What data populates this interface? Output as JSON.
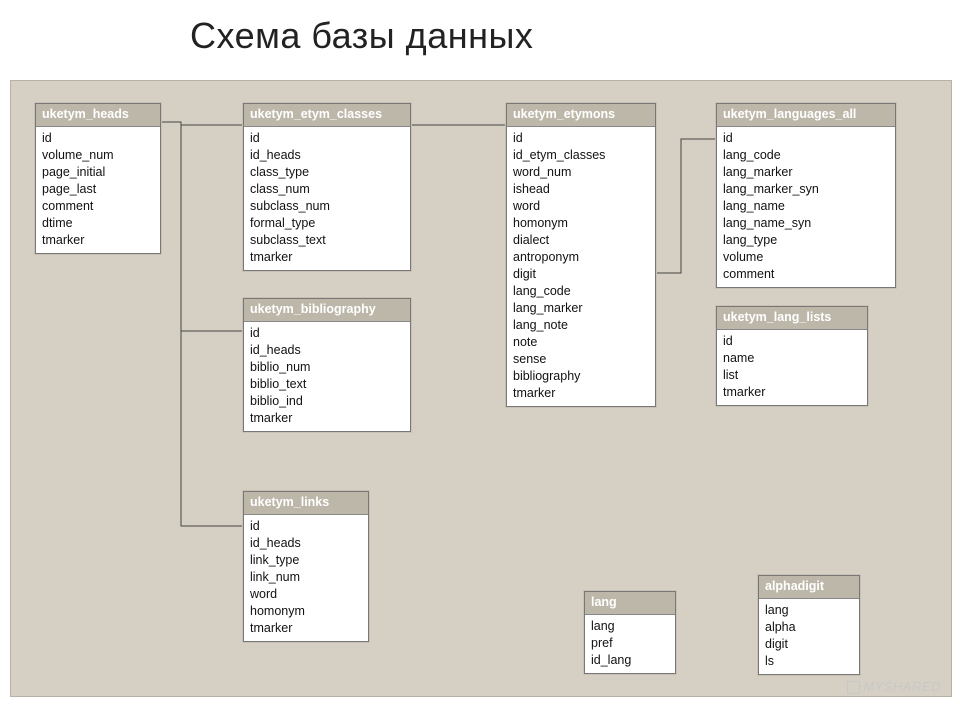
{
  "title": "Схема базы данных",
  "watermark": "MYSHARED",
  "tables": {
    "uketym_heads": {
      "title": "uketym_heads",
      "fields": [
        "id",
        "volume_num",
        "page_initial",
        "page_last",
        "comment",
        "dtime",
        "tmarker"
      ]
    },
    "uketym_etym_classes": {
      "title": "uketym_etym_classes",
      "fields": [
        "id",
        "id_heads",
        "class_type",
        "class_num",
        "subclass_num",
        "formal_type",
        "subclass_text",
        "tmarker"
      ]
    },
    "uketym_etymons": {
      "title": "uketym_etymons",
      "fields": [
        "id",
        "id_etym_classes",
        "word_num",
        "ishead",
        "word",
        "homonym",
        "dialect",
        "antroponym",
        "digit",
        "lang_code",
        "lang_marker",
        "lang_note",
        "note",
        "sense",
        "bibliography",
        "tmarker"
      ]
    },
    "uketym_languages_all": {
      "title": "uketym_languages_all",
      "fields": [
        "id",
        "lang_code",
        "lang_marker",
        "lang_marker_syn",
        "lang_name",
        "lang_name_syn",
        "lang_type",
        "volume",
        "comment"
      ]
    },
    "uketym_bibliography": {
      "title": "uketym_bibliography",
      "fields": [
        "id",
        "id_heads",
        "biblio_num",
        "biblio_text",
        "biblio_ind",
        "tmarker"
      ]
    },
    "uketym_lang_lists": {
      "title": "uketym_lang_lists",
      "fields": [
        "id",
        "name",
        "list",
        "tmarker"
      ]
    },
    "uketym_links": {
      "title": "uketym_links",
      "fields": [
        "id",
        "id_heads",
        "link_type",
        "link_num",
        "word",
        "homonym",
        "tmarker"
      ]
    },
    "lang": {
      "title": "lang",
      "fields": [
        "lang",
        "pref",
        "id_lang"
      ]
    },
    "alphadigit": {
      "title": "alphadigit",
      "fields": [
        "lang",
        "alpha",
        "digit",
        "ls"
      ]
    }
  }
}
